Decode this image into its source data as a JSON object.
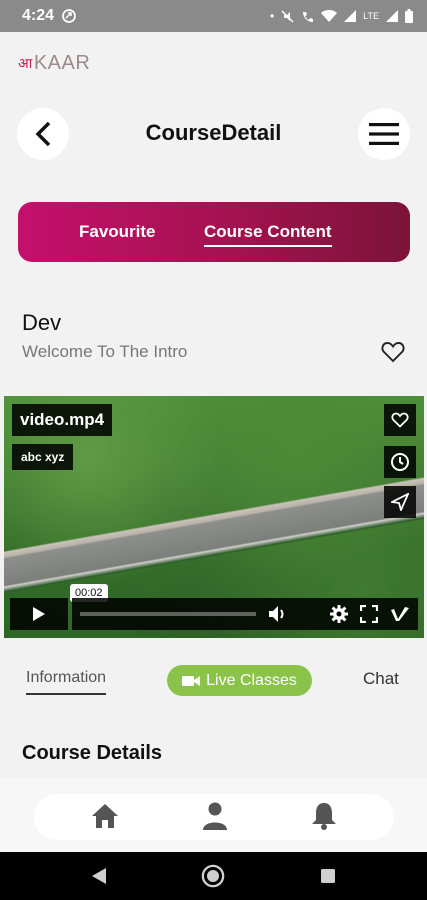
{
  "status_bar": {
    "time": "4:24",
    "network_label": "LTE"
  },
  "app": {
    "logo_text": "KAAR",
    "logo_mark": "आ"
  },
  "header": {
    "title": "CourseDetail"
  },
  "segment": {
    "items": [
      "Favourite",
      "Course Content"
    ],
    "selected": "Course Content"
  },
  "course": {
    "name": "Dev",
    "subtitle": "Welcome To The Intro"
  },
  "video": {
    "title": "video.mp4",
    "author": "abc xyz",
    "timestamp": "00:02"
  },
  "tabs": {
    "information": "Information",
    "live": "Live Classes",
    "chat": "Chat"
  },
  "section": {
    "title": "Course Details"
  },
  "colors": {
    "accent": "#c4106d",
    "accent_dark": "#7a1438",
    "live_green": "#8bc34a"
  },
  "icons": {
    "bottom_nav": [
      "home-icon",
      "profile-icon",
      "bell-icon"
    ]
  }
}
